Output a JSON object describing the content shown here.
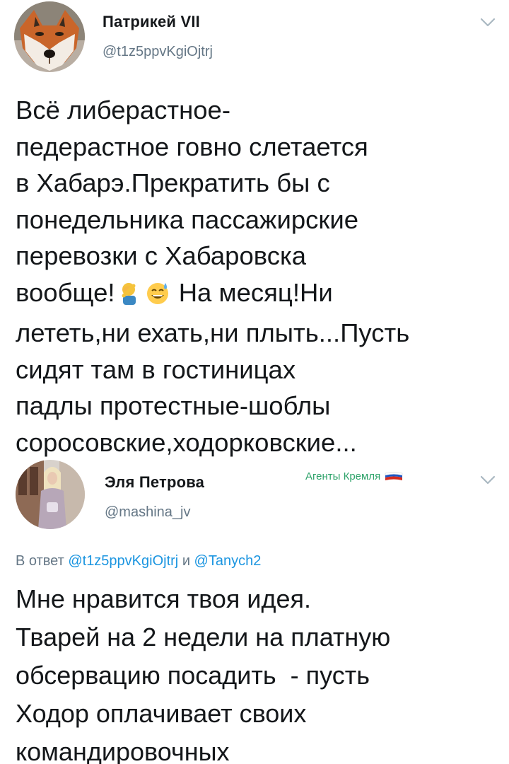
{
  "tweets": [
    {
      "display_name": "Патрикей VII",
      "handle": "@t1z5ppvKgiOjtrj",
      "avatar_icon": "fox-avatar-icon",
      "menu_icon": "chevron-down-icon",
      "body_lines": [
        "Всё либерастное-",
        "педерастное говно слетается",
        "в Хабарэ.Прекратить бы с",
        "понедельника пассажирские",
        "перевозки с Хабаровска",
        "вообще!",
        "На месяц!Ни",
        "лететь,ни ехать,ни плыть...Пусть",
        "сидят там в гостиницах",
        "падлы протестные-шоблы",
        "соросовские,ходорковские..."
      ],
      "emojis": [
        "facepalm-emoji",
        "sweat-smile-emoji"
      ]
    },
    {
      "display_name": "Эля Петрова",
      "handle": "@mashina_jv",
      "avatar_icon": "woman-avatar-icon",
      "menu_icon": "chevron-down-icon",
      "badge_text": "Агенты Кремля",
      "badge_icon": "russia-flag-icon",
      "reply_prefix": "В ответ",
      "reply_to_1": "@t1z5ppvKgiOjtrj",
      "reply_and": "и",
      "reply_to_2": "@Tanych2",
      "body_lines": [
        "Мне нравится твоя идея.",
        "Тварей на 2 недели на платную",
        "обсервацию посадить  - пусть",
        "Ходор оплачивает своих",
        "командировочных"
      ]
    }
  ],
  "colors": {
    "text": "#14171a",
    "secondary": "#657786",
    "link": "#1b95e0",
    "badge": "#2fa36b"
  }
}
